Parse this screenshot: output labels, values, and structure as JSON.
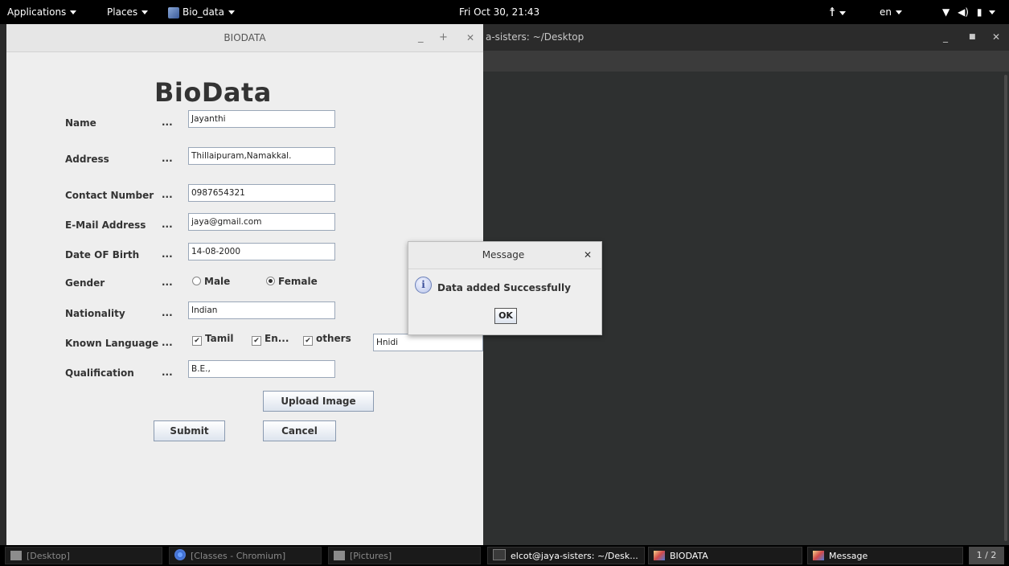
{
  "top_panel": {
    "applications": "Applications",
    "places": "Places",
    "app_menu": "Bio_data",
    "clock": "Fri Oct 30, 21:43",
    "language": "en"
  },
  "terminal": {
    "title": "a-sisters: ~/Desktop"
  },
  "biodata_window": {
    "title": "BIODATA",
    "heading": "BioData",
    "fields": [
      {
        "label": "Name",
        "dots": "...",
        "value": "Jayanthi"
      },
      {
        "label": "Address",
        "dots": "...",
        "value": "Thillaipuram,Namakkal."
      },
      {
        "label": "Contact Number",
        "dots": "...",
        "value": "0987654321"
      },
      {
        "label": "E-Mail Address",
        "dots": "...",
        "value": "jaya@gmail.com"
      },
      {
        "label": "Date OF Birth",
        "dots": "...",
        "value": "14-08-2000"
      }
    ],
    "gender": {
      "label": "Gender",
      "dots": "...",
      "options": [
        "Male",
        "Female"
      ],
      "selected": "Female"
    },
    "nationality": {
      "label": "Nationality",
      "dots": "...",
      "value": "Indian"
    },
    "known_language": {
      "label": "Known Language",
      "dots": "...",
      "options": [
        {
          "label": "Tamil",
          "checked": true
        },
        {
          "label": "En...",
          "checked": true
        },
        {
          "label": "others",
          "checked": true
        }
      ],
      "other_value": "Hnidi"
    },
    "qualification": {
      "label": "Qualification",
      "dots": "...",
      "value": "B.E.,"
    },
    "upload_button": "Upload Image",
    "submit_button": "Submit",
    "cancel_button": "Cancel"
  },
  "dialog": {
    "title": "Message",
    "message": "Data added Successfully",
    "ok": "OK"
  },
  "taskbar": {
    "items": [
      {
        "label": "[Desktop]",
        "state": "minimized"
      },
      {
        "label": "[Classes - Chromium]",
        "state": "minimized"
      },
      {
        "label": "[Pictures]",
        "state": "minimized"
      },
      {
        "label": "elcot@jaya-sisters: ~/Desk...",
        "state": "open"
      },
      {
        "label": "BIODATA",
        "state": "open"
      },
      {
        "label": "Message",
        "state": "open"
      }
    ],
    "pager": "1 / 2"
  }
}
